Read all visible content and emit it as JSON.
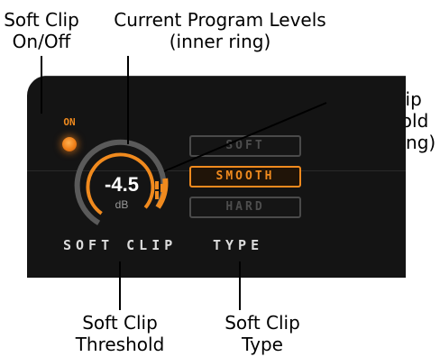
{
  "callouts": {
    "soft_clip_onoff": "Soft Clip\nOn/Off",
    "program_levels": "Current Program Levels\n(inner ring)",
    "threshold_outer": "Soft Clip\nThreshold\n(outer ring)",
    "threshold": "Soft Clip\nThreshold",
    "type": "Soft Clip\nType"
  },
  "panel": {
    "on_label": "ON",
    "knob": {
      "value": "-4.5",
      "unit": "dB"
    },
    "type_buttons": [
      {
        "label": "SOFT",
        "active": false
      },
      {
        "label": "SMOOTH",
        "active": true
      },
      {
        "label": "HARD",
        "active": false
      }
    ],
    "soft_clip_label": "SOFT CLIP",
    "type_label": "TYPE"
  },
  "colors": {
    "accent": "#f08a1e",
    "panel_bg": "#141414",
    "ring_gray": "#5a5a5a",
    "inactive_button": "#4a4a4a"
  }
}
